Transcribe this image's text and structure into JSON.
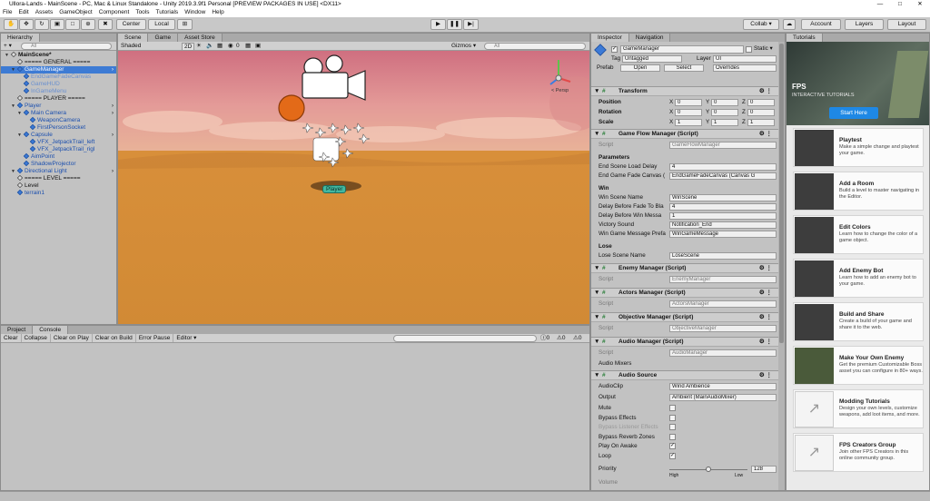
{
  "window": {
    "title": "Ullora-Lands - MainScene - PC, Mac & Linux Standalone - Unity 2019.3.9f1 Personal [PREVIEW PACKAGES IN USE] <DX11>"
  },
  "menu": [
    "File",
    "Edit",
    "Assets",
    "GameObject",
    "Component",
    "Tools",
    "Tutorials",
    "Window",
    "Help"
  ],
  "toolbar": {
    "pivot": "Center",
    "space": "Local",
    "collab": "Collab ▾",
    "account": "Account",
    "layers": "Layers",
    "layout": "Layout"
  },
  "hierarchy": {
    "tab": "Hierarchy",
    "plus": "+ ▾",
    "search": "All",
    "items": [
      {
        "label": "MainScene*",
        "indent": 0,
        "kind": "scene"
      },
      {
        "label": "===== GENERAL =====",
        "indent": 1,
        "kind": "obj"
      },
      {
        "label": "GameManager",
        "indent": 1,
        "kind": "prefab",
        "selected": true
      },
      {
        "label": "EndGameFadeCanvas",
        "indent": 2,
        "kind": "prefab-child"
      },
      {
        "label": "GameHUD",
        "indent": 2,
        "kind": "prefab-child"
      },
      {
        "label": "InGameMenu",
        "indent": 2,
        "kind": "prefab-child"
      },
      {
        "label": "===== PLAYER =====",
        "indent": 1,
        "kind": "obj"
      },
      {
        "label": "Player",
        "indent": 1,
        "kind": "prefab"
      },
      {
        "label": "Main Camera",
        "indent": 2,
        "kind": "prefab"
      },
      {
        "label": "WeaponCamera",
        "indent": 3,
        "kind": "prefab"
      },
      {
        "label": "FirstPersonSocket",
        "indent": 3,
        "kind": "prefab"
      },
      {
        "label": "Capsule",
        "indent": 2,
        "kind": "prefab"
      },
      {
        "label": "VFX_JetpackTrail_left",
        "indent": 3,
        "kind": "prefab"
      },
      {
        "label": "VFX_JetpackTrail_rigl",
        "indent": 3,
        "kind": "prefab"
      },
      {
        "label": "AimPoint",
        "indent": 2,
        "kind": "prefab"
      },
      {
        "label": "ShadowProjector",
        "indent": 2,
        "kind": "prefab"
      },
      {
        "label": "Directional Light",
        "indent": 1,
        "kind": "prefab"
      },
      {
        "label": "===== LEVEL =====",
        "indent": 1,
        "kind": "obj"
      },
      {
        "label": "Level",
        "indent": 1,
        "kind": "obj"
      },
      {
        "label": "terrain1",
        "indent": 1,
        "kind": "prefab"
      }
    ]
  },
  "scene": {
    "tabs": [
      "Scene",
      "Game",
      "Asset Store"
    ],
    "shading": "Shaded",
    "mode": "2D",
    "gizmos": "Gizmos ▾",
    "search": "All",
    "counter": "0",
    "player_label": "Player",
    "persp": "< Persp"
  },
  "console": {
    "tabs": [
      "Project",
      "Console"
    ],
    "buttons": [
      "Clear",
      "Collapse",
      "Clear on Play",
      "Clear on Build",
      "Error Pause",
      "Editor ▾"
    ],
    "counts": [
      "0",
      "0",
      "0"
    ]
  },
  "inspector": {
    "tabs": [
      "Inspector",
      "Navigation"
    ],
    "name": "GameManager",
    "static": "Static ▾",
    "tag_label": "Tag",
    "tag": "Untagged",
    "layer_label": "Layer",
    "layer": "UI",
    "prefab_label": "Prefab",
    "prefab_open": "Open",
    "prefab_select": "Select",
    "prefab_overrides": "Overrides",
    "transform": {
      "title": "Transform",
      "rows": [
        {
          "label": "Position",
          "x": "0",
          "y": "0",
          "z": "0"
        },
        {
          "label": "Rotation",
          "x": "0",
          "y": "0",
          "z": "0"
        },
        {
          "label": "Scale",
          "x": "1",
          "y": "1",
          "z": "1"
        }
      ]
    },
    "gfm": {
      "title": "Game Flow Manager (Script)",
      "script_label": "Script",
      "script": "GameFlowManager",
      "params": "Parameters",
      "end_delay_label": "End Scene Load Delay",
      "end_delay": "4",
      "fade_canvas_label": "End Game Fade Canvas (",
      "fade_canvas": "EndGameFadeCanvas (Canvas G",
      "win": "Win",
      "win_scene_label": "Win Scene Name",
      "win_scene": "WinScene",
      "delay_fade_label": "Delay Before Fade To Bla",
      "delay_fade": "4",
      "delay_win_label": "Delay Before Win Messa",
      "delay_win": "1",
      "victory_label": "Victory Sound",
      "victory": "Notification_End",
      "win_msg_label": "Win Game Message Prefa",
      "win_msg": "WinGameMessage",
      "lose": "Lose",
      "lose_scene_label": "Lose Scene Name",
      "lose_scene": "LoseScene"
    },
    "scripts": [
      {
        "title": "Enemy Manager (Script)",
        "script": "EnemyManager"
      },
      {
        "title": "Actors Manager (Script)",
        "script": "ActorsManager"
      },
      {
        "title": "Objective Manager (Script)",
        "script": "ObjectiveManager"
      },
      {
        "title": "Audio Manager (Script)",
        "script": "AudioManager"
      }
    ],
    "audio_mixers": "Audio Mixers",
    "audio_source": {
      "title": "Audio Source",
      "clip_label": "AudioClip",
      "clip": "Wind Ambience",
      "output_label": "Output",
      "output": "Ambient (MainAudioMixer)",
      "flags": [
        {
          "label": "Mute",
          "checked": false
        },
        {
          "label": "Bypass Effects",
          "checked": false
        },
        {
          "label": "Bypass Listener Effects",
          "checked": false,
          "disabled": true
        },
        {
          "label": "Bypass Reverb Zones",
          "checked": false
        },
        {
          "label": "Play On Awake",
          "checked": true
        },
        {
          "label": "Loop",
          "checked": true
        }
      ],
      "priority_label": "Priority",
      "priority": "128",
      "priority_fraction": 0.5,
      "high": "High",
      "low": "Low",
      "volume_label": "Volume"
    }
  },
  "tutorials": {
    "tab": "Tutorials",
    "banner_title": "FPS",
    "banner_sub": "INTERACTIVE TUTORIALS",
    "start": "Start Here",
    "cards": [
      {
        "title": "Playtest",
        "desc": "Make a simple change and playtest your game."
      },
      {
        "title": "Add a Room",
        "desc": "Build a level to master navigating in the Editor."
      },
      {
        "title": "Edit Colors",
        "desc": "Learn how to change the color of a game object."
      },
      {
        "title": "Add Enemy Bot",
        "desc": "Learn how to add an enemy bot to your game."
      },
      {
        "title": "Build and Share",
        "desc": "Create a build of your game and share it to the web."
      },
      {
        "title": "Make Your Own Enemy",
        "desc": "Get the premium Customizable Boss asset you can configure in 80+ ways."
      },
      {
        "title": "Modding Tutorials",
        "desc": "Design your own levels, customize weapons, add loot items, and more."
      },
      {
        "title": "FPS Creators Group",
        "desc": "Join other FPS Creators in this online community group."
      }
    ]
  },
  "colors": {
    "accent": "#1e88e5",
    "selected": "#3d7bd4",
    "sky_top": "#d87b8a",
    "ground": "#d3923a"
  }
}
